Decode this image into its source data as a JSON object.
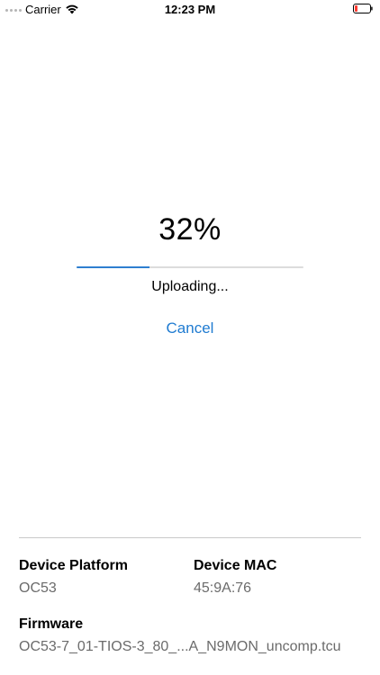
{
  "status_bar": {
    "carrier": "Carrier",
    "time": "12:23 PM",
    "battery_color": "#ff3b30"
  },
  "upload": {
    "percent_label": "32%",
    "progress": 0.32,
    "status": "Uploading...",
    "cancel_label": "Cancel",
    "accent_color": "#1f7bd1"
  },
  "device_info": {
    "platform_label": "Device Platform",
    "platform_value": "OC53",
    "mac_label": "Device MAC",
    "mac_value": "45:9A:76",
    "firmware_label": "Firmware",
    "firmware_value": "OC53-7_01-TIOS-3_80_...A_N9MON_uncomp.tcu"
  }
}
